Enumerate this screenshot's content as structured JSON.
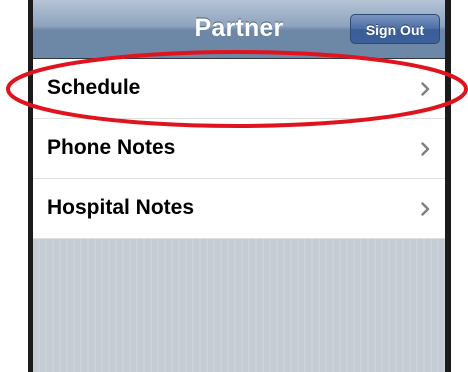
{
  "navbar": {
    "title": "Partner",
    "sign_out_label": "Sign Out"
  },
  "menu": {
    "items": [
      {
        "label": "Schedule",
        "icon": "chevron-right-icon"
      },
      {
        "label": "Phone Notes",
        "icon": "chevron-right-icon"
      },
      {
        "label": "Hospital Notes",
        "icon": "chevron-right-icon"
      }
    ]
  },
  "annotation": {
    "highlight_color": "#e0141e",
    "highlighted_item": "Schedule"
  },
  "colors": {
    "navbar": "#6d87a7",
    "button": "#3d609a",
    "background": "#c5ccd4",
    "chevron": "#7f7f7f"
  }
}
